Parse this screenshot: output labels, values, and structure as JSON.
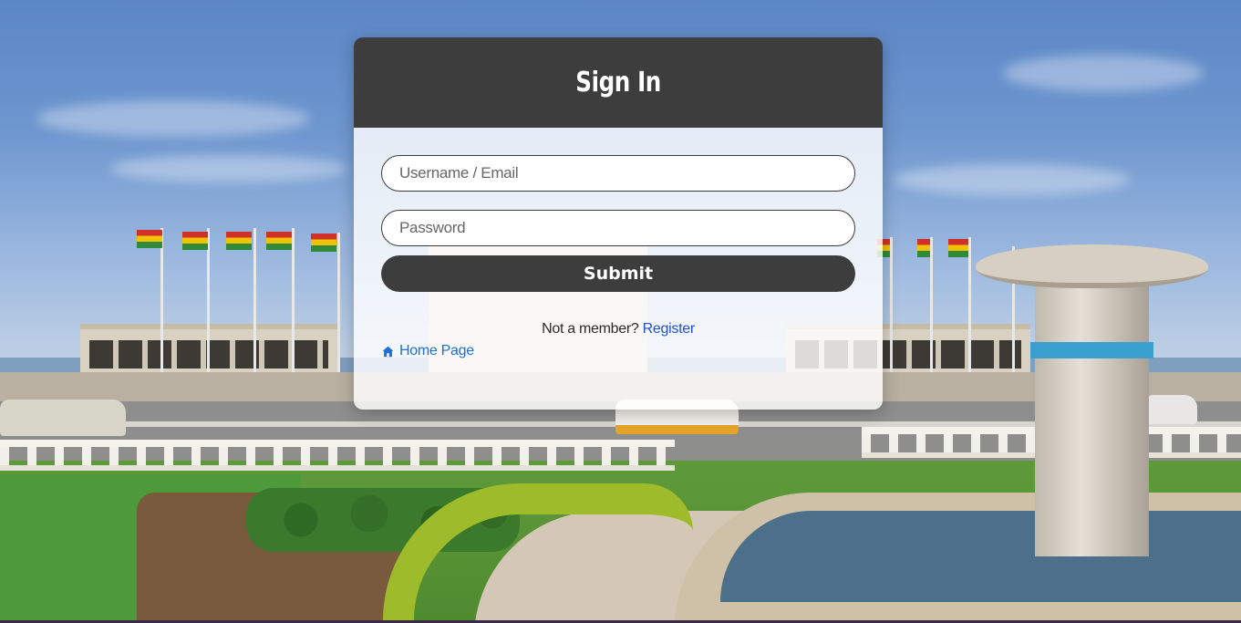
{
  "header": {
    "title": "Sign In"
  },
  "form": {
    "username_placeholder": "Username / Email",
    "username_value": "",
    "password_placeholder": "Password",
    "password_value": "",
    "submit_label": "Submit"
  },
  "footer": {
    "member_prompt": "Not a member?",
    "register_label": "Register",
    "home_label": "Home Page"
  },
  "icons": {
    "home": "home-icon"
  },
  "colors": {
    "header_bg": "#3d3d3d",
    "submit_bg": "#3d3d3d",
    "link": "#1f4fd6",
    "home_link": "#1f6fd6"
  }
}
